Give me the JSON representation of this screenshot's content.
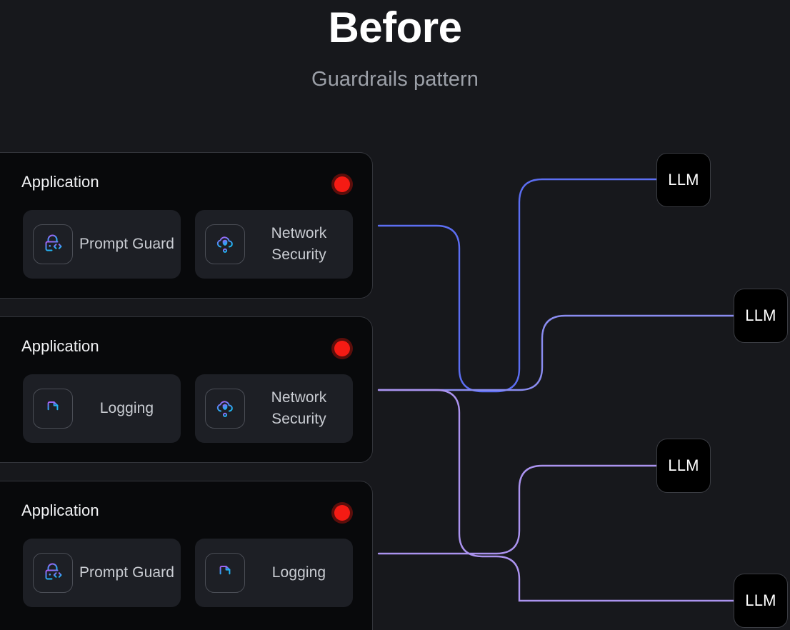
{
  "header": {
    "title": "Before",
    "subtitle": "Guardrails pattern"
  },
  "colors": {
    "background": "#17181c",
    "card_background": "#08090b",
    "card_border": "#32343a",
    "pill_background": "#1d1f25",
    "status_dot": "#f51b14",
    "wire_blue": "#5c6ef2",
    "wire_periwinkle": "#8a8cf0",
    "wire_lavender": "#ab93ef",
    "icon_gradient_start": "#a855f7",
    "icon_gradient_end": "#22a7f0",
    "title_text": "#ffffff",
    "subtitle_text": "#9ca0a8",
    "label_text": "#c9ccd2"
  },
  "applications": [
    {
      "title": "Application",
      "status": "red",
      "features": [
        {
          "label": "Prompt Guard",
          "icon": "lock-code-icon"
        },
        {
          "label": "Network Security",
          "icon": "cloud-shield-icon"
        }
      ]
    },
    {
      "title": "Application",
      "status": "red",
      "features": [
        {
          "label": "Logging",
          "icon": "document-shredder-icon"
        },
        {
          "label": "Network Security",
          "icon": "cloud-shield-icon"
        }
      ]
    },
    {
      "title": "Application",
      "status": "red",
      "features": [
        {
          "label": "Prompt Guard",
          "icon": "lock-code-icon"
        },
        {
          "label": "Logging",
          "icon": "document-shredder-icon"
        }
      ]
    }
  ],
  "llm_nodes": [
    {
      "label": "LLM"
    },
    {
      "label": "LLM"
    },
    {
      "label": "LLM"
    },
    {
      "label": "LLM"
    }
  ]
}
